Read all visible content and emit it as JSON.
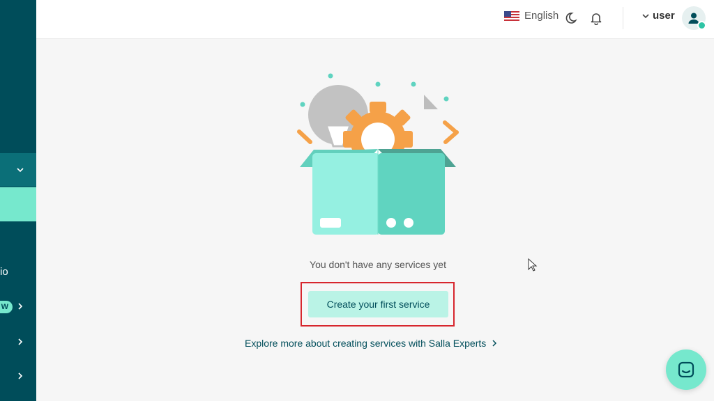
{
  "header": {
    "language_label": "English",
    "user_name": "user"
  },
  "sidebar": {
    "partial_text": "io",
    "badge_text": "W"
  },
  "main": {
    "empty_message": "You don't have any services yet",
    "create_button_label": "Create your first service",
    "explore_link_label": "Explore more about creating services with Salla Experts"
  },
  "icons": {
    "flag": "us-flag-icon",
    "theme": "moon-icon",
    "notifications": "bell-icon",
    "user": "user-icon",
    "chat": "chat-icon"
  },
  "colors": {
    "sidebar": "#004d5a",
    "accent": "#76e8cd",
    "button_bg": "#baf3e6",
    "highlight": "#d7262d"
  }
}
